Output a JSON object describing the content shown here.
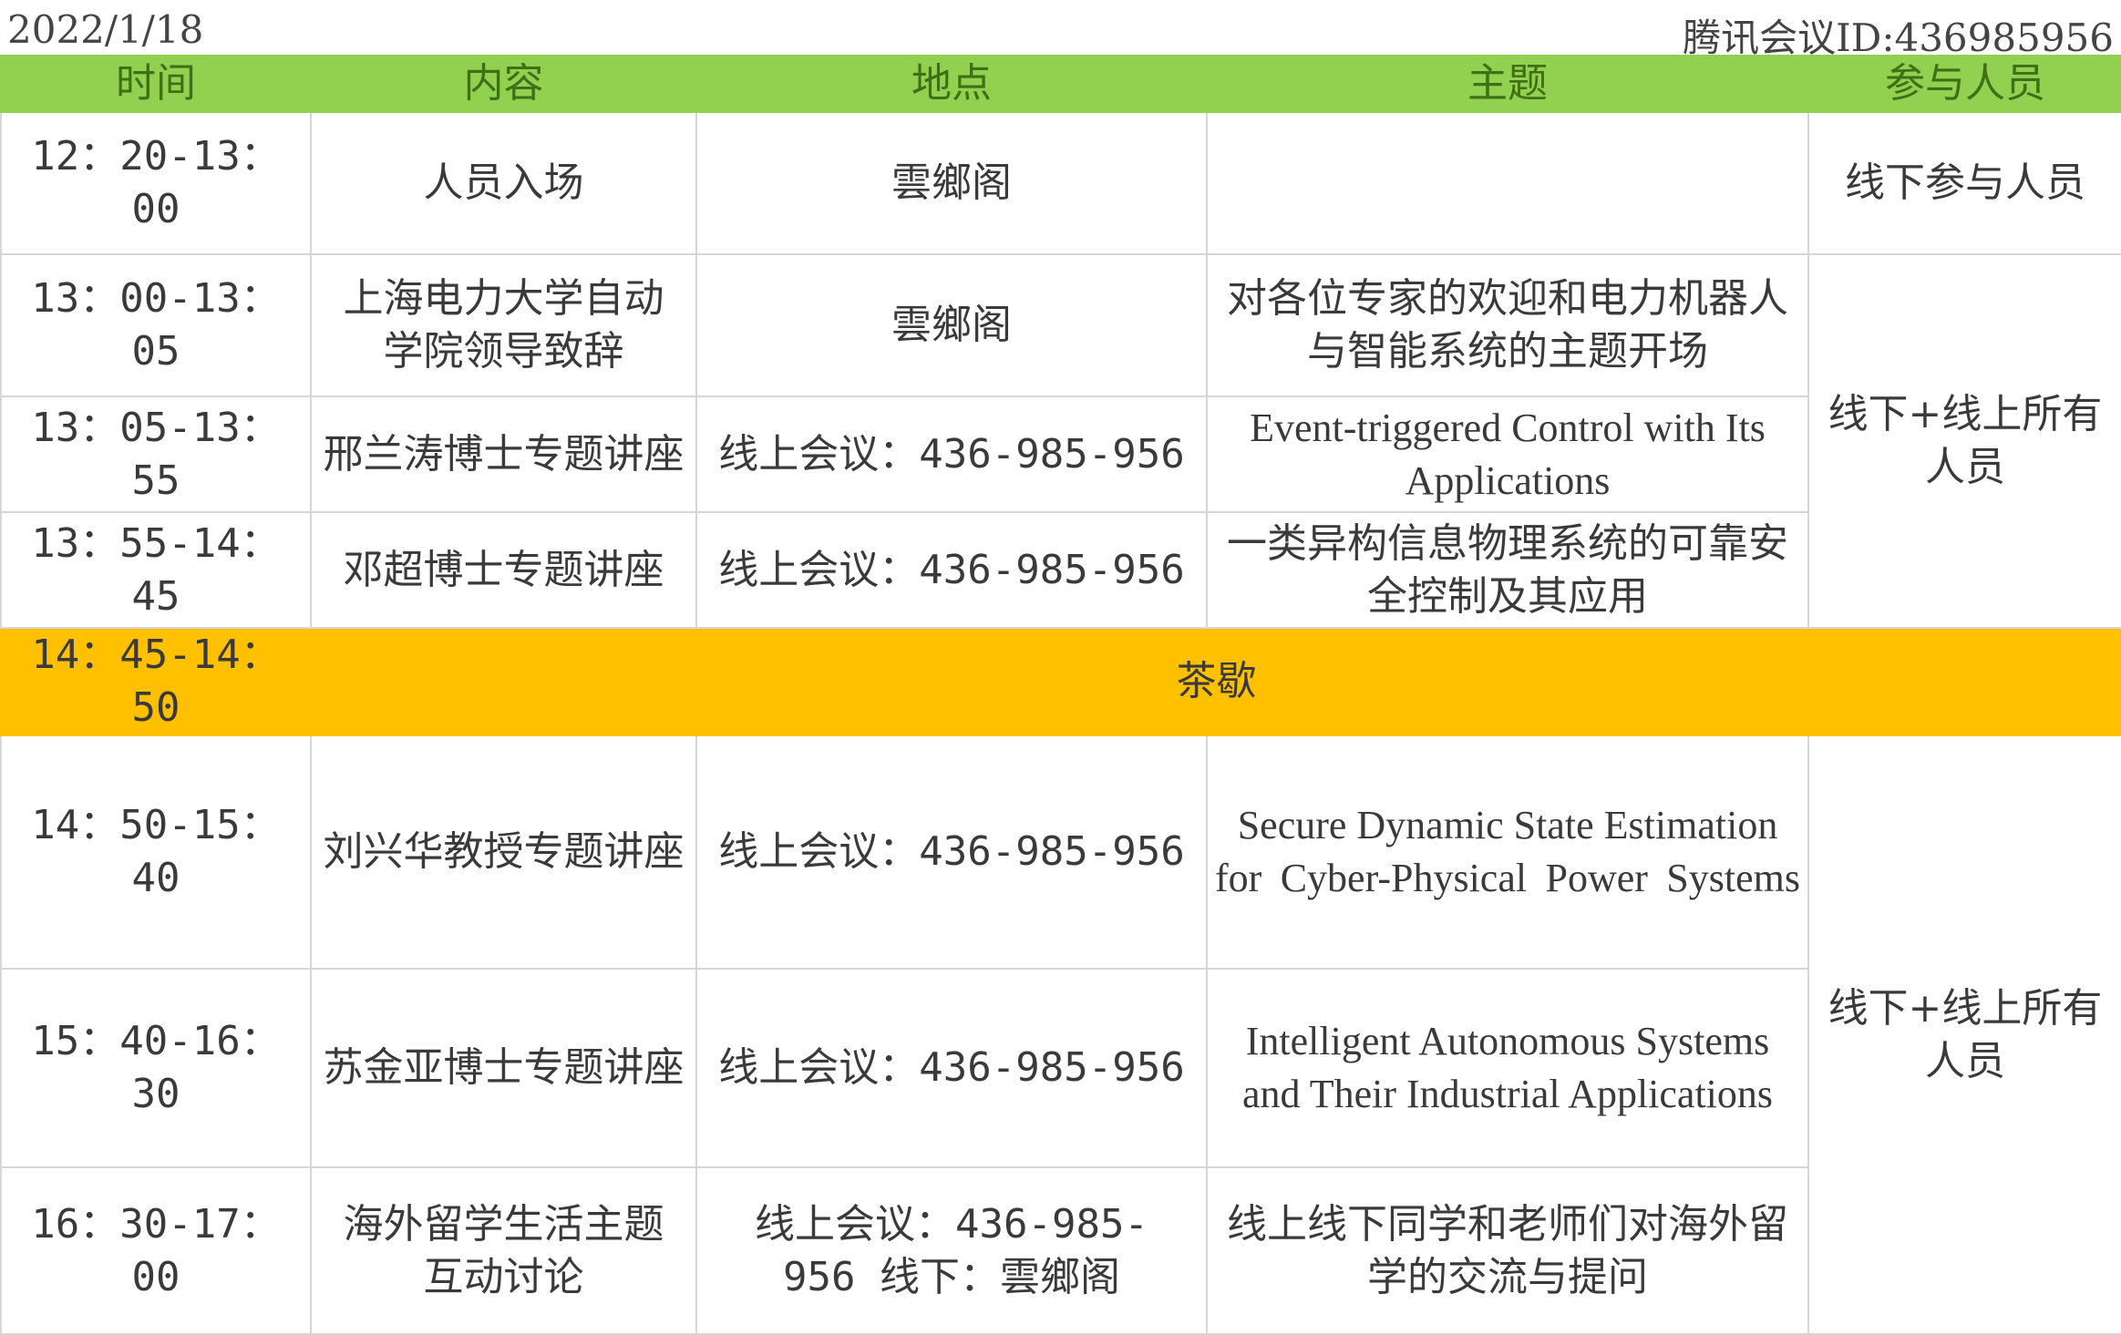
{
  "header": {
    "date": "2022/1/18",
    "meeting_id": "腾讯会议ID:436985956"
  },
  "columns": [
    "时间",
    "内容",
    "地点",
    "主题",
    "参与人员"
  ],
  "rows": [
    {
      "time": "12：20-13：00",
      "content": "人员入场",
      "location": "雲鄉阁",
      "topic": "",
      "participants": "线下参与人员"
    },
    {
      "time": "13：00-13：05",
      "content": "上海电力大学自动学院领导致辞",
      "location": "雲鄉阁",
      "topic": "对各位专家的欢迎和电力机器人与智能系统的主题开场",
      "participants": "线下+线上所有人员"
    },
    {
      "time": "13：05-13：55",
      "content": "邢兰涛博士专题讲座",
      "location": "线上会议：436-985-956",
      "topic": "Event-triggered Control with Its Applications"
    },
    {
      "time": "13：55-14：45",
      "content": "邓超博士专题讲座",
      "location": "线上会议：436-985-956",
      "topic": "一类异构信息物理系统的可靠安全控制及其应用"
    },
    {
      "time": "14：45-14：50",
      "break_label": "茶歇"
    },
    {
      "time": "14：50-15：40",
      "content": "刘兴华教授专题讲座",
      "location": "线上会议：436-985-956",
      "topic": "Secure Dynamic State Estimation for Cyber-Physical Power Systems",
      "participants": "线下+线上所有人员"
    },
    {
      "time": "15：40-16：30",
      "content": "苏金亚博士专题讲座",
      "location": "线上会议：436-985-956",
      "topic": "Intelligent Autonomous Systems and Their Industrial Applications"
    },
    {
      "time": "16：30-17：00",
      "content": "海外留学生活主题互动讨论",
      "location": "线上会议：436-985-956 线下：雲鄉阁",
      "topic": "线上线下同学和老师们对海外留学的交流与提问"
    }
  ],
  "colors": {
    "header_bg": "#92d050",
    "break_bg": "#ffc000",
    "border": "#d6d6d6"
  }
}
